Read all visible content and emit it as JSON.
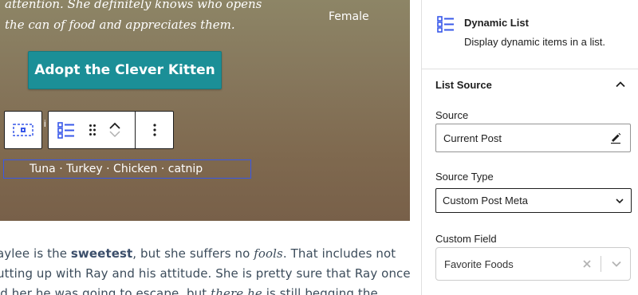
{
  "canvas": {
    "hero": {
      "text_lines": [
        "attention. She definitely knows who opens",
        "the can of food and appreciates them."
      ],
      "gender": "Female",
      "button_label": "Adopt the Clever Kitten"
    },
    "toolbar_marker": "i",
    "dynamic_list": {
      "items": [
        "Tuna",
        "Turkey",
        "Chicken",
        "catnip"
      ],
      "separator": " · "
    },
    "paragraph": {
      "line1": {
        "pre": "aylee is the ",
        "bold": "sweetest",
        "mid": ", but she suffers no ",
        "italic": "fools",
        "post": ". That includes not"
      },
      "line2": "utting up with Ray and his attitude. She is pretty sure that Ray once",
      "line3": {
        "pre": "ld her he was going to escape, but ",
        "italic": "there he",
        "post": " is still begging the"
      }
    }
  },
  "sidebar": {
    "block_card": {
      "title": "Dynamic List",
      "description": "Display dynamic items in a list.",
      "icon": "list-icon"
    },
    "panel": {
      "title": "List Source",
      "expanded": true,
      "source": {
        "label": "Source",
        "value": "Current Post",
        "edit_icon": "pencil-icon"
      },
      "source_type": {
        "label": "Source Type",
        "value": "Custom Post Meta"
      },
      "custom_field": {
        "label": "Custom Field",
        "value": "Favorite Foods"
      }
    }
  },
  "colors": {
    "accent": "#3858e9",
    "button": "#1b8f97",
    "icon_blue": "#3858e9"
  }
}
